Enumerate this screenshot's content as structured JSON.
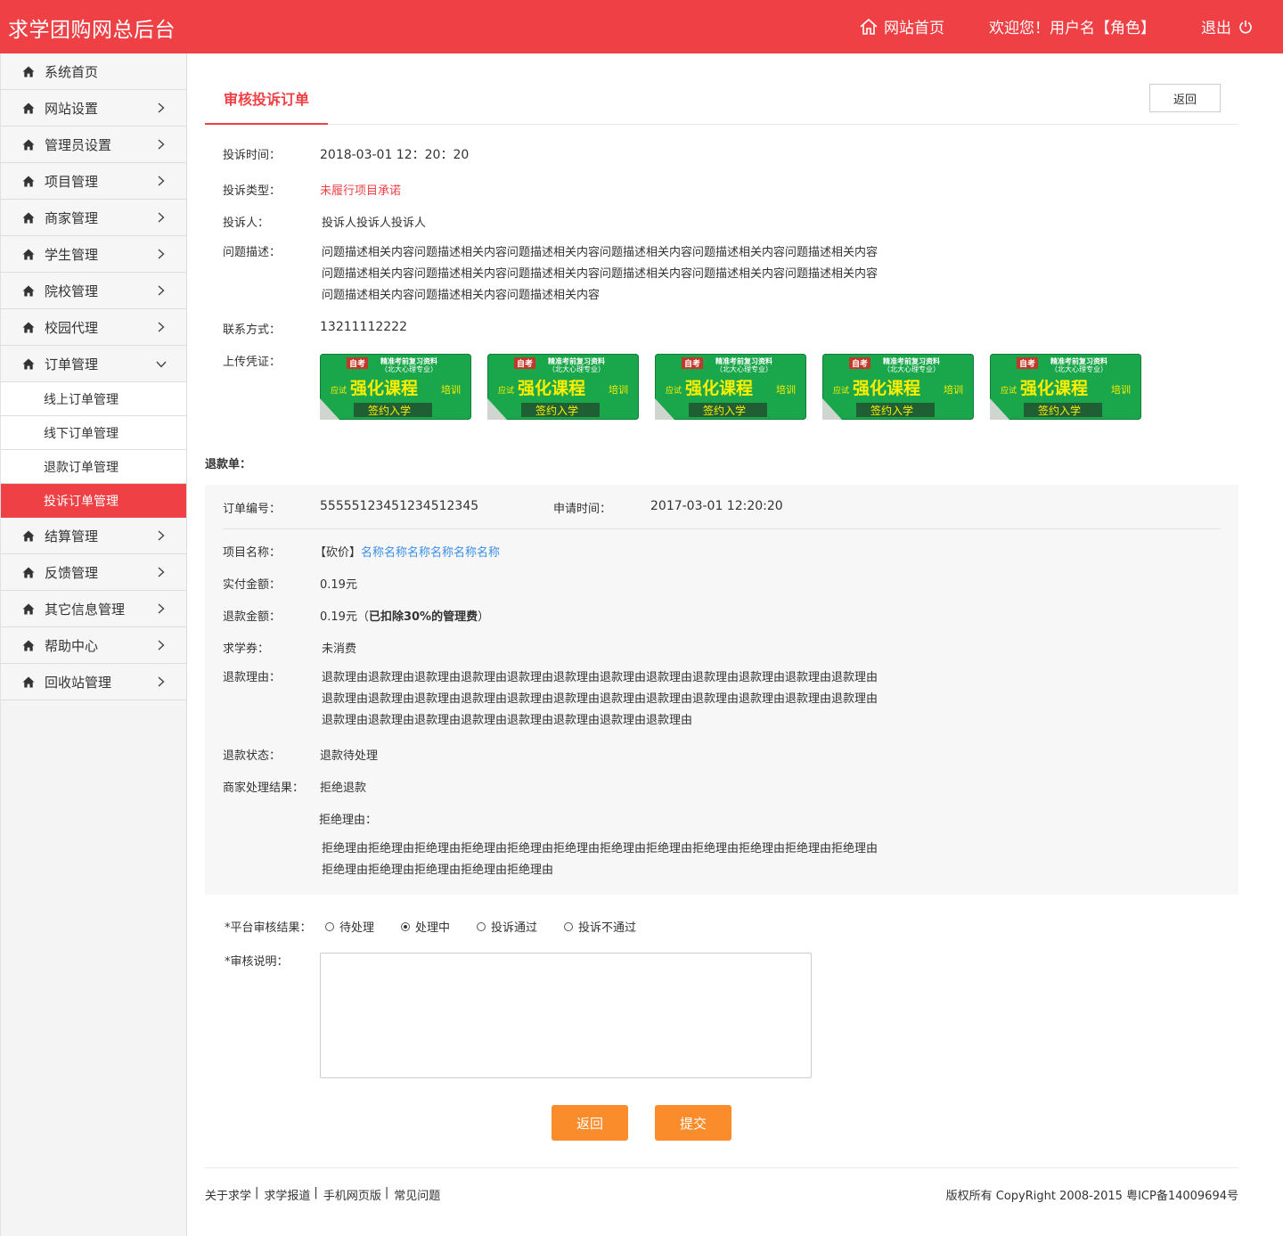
{
  "header": {
    "brand": "求学团购网总后台",
    "home_link": "网站首页",
    "welcome": "欢迎您！用户名【角色】",
    "logout": "退出"
  },
  "sidebar": {
    "items": [
      {
        "label": "系统首页"
      },
      {
        "label": "网站设置"
      },
      {
        "label": "管理员设置"
      },
      {
        "label": "项目管理"
      },
      {
        "label": "商家管理"
      },
      {
        "label": "学生管理"
      },
      {
        "label": "院校管理"
      },
      {
        "label": "校园代理"
      },
      {
        "label": "订单管理"
      },
      {
        "label": "结算管理"
      },
      {
        "label": "反馈管理"
      },
      {
        "label": "其它信息管理"
      },
      {
        "label": "帮助中心"
      },
      {
        "label": "回收站管理"
      }
    ],
    "order_sub": [
      {
        "label": "线上订单管理"
      },
      {
        "label": "线下订单管理"
      },
      {
        "label": "退款订单管理"
      },
      {
        "label": "投诉订单管理"
      }
    ]
  },
  "page": {
    "tab_title": "审核投诉订单",
    "back_top": "返回"
  },
  "complaint": {
    "time_label": "投诉时间：",
    "time": "2018-03-01 12：20：20",
    "type_label": "投诉类型：",
    "type": "未履行项目承诺",
    "person_label": "投诉人：",
    "person": "投诉人投诉人投诉人",
    "desc_label": "问题描述：",
    "desc_line1": "问题描述相关内容问题描述相关内容问题描述相关内容问题描述相关内容问题描述相关内容问题描述相关内容",
    "desc_line2": "问题描述相关内容问题描述相关内容问题描述相关内容问题描述相关内容问题描述相关内容问题描述相关内容",
    "desc_line3": "问题描述相关内容问题描述相关内容问题描述相关内容",
    "contact_label": "联系方式：",
    "contact": "13211112222",
    "upload_label": "上传凭证："
  },
  "voucher_image": {
    "badge": "自考",
    "top1": "精准考前复习资料",
    "top2": "（北大心理专业）",
    "left": "应试",
    "big": "强化课程",
    "right": "培训",
    "bottom": "签约入学"
  },
  "refund": {
    "section_title": "退款单：",
    "order_no_label": "订单编号：",
    "order_no": "55555123451234512345",
    "apply_time_label": "申请时间：",
    "apply_time": "2017-03-01 12:20:20",
    "project_label": "项目名称：",
    "project_tag": "【砍价】",
    "project_name": "名称名称名称名称名称名称",
    "paid_label": "实付金额：",
    "paid": "0.19元",
    "refund_amount_label": "退款金额：",
    "refund_amount_value": "0.19元（",
    "refund_amount_note": "已扣除30%的管理费",
    "refund_amount_close": "）",
    "coupon_label": "求学券：",
    "coupon": "未消费",
    "reason_label": "退款理由：",
    "reason_line1": "退款理由退款理由退款理由退款理由退款理由退款理由退款理由退款理由退款理由退款理由退款理由退款理由",
    "reason_line2": "退款理由退款理由退款理由退款理由退款理由退款理由退款理由退款理由退款理由退款理由退款理由退款理由",
    "reason_line3": "退款理由退款理由退款理由退款理由退款理由退款理由退款理由退款理由",
    "status_label": "退款状态：",
    "status": "退款待处理",
    "merchant_result_label": "商家处理结果：",
    "merchant_result": "拒绝退款",
    "reject_reason_label": "拒绝理由：",
    "reject_line1": "拒绝理由拒绝理由拒绝理由拒绝理由拒绝理由拒绝理由拒绝理由拒绝理由拒绝理由拒绝理由拒绝理由拒绝理由",
    "reject_line2": "拒绝理由拒绝理由拒绝理由拒绝理由拒绝理由"
  },
  "review": {
    "result_label": "*平台审核结果：",
    "options": [
      {
        "label": "待处理",
        "checked": false
      },
      {
        "label": "处理中",
        "checked": true
      },
      {
        "label": "投诉通过",
        "checked": false
      },
      {
        "label": "投诉不通过",
        "checked": false
      }
    ],
    "note_label": "*审核说明：",
    "note_value": "",
    "back_button": "返回",
    "submit_button": "提交"
  },
  "footer": {
    "links": [
      "关于求学",
      "求学报道",
      "手机网页版",
      "常见问题"
    ],
    "separator": "|",
    "copyright": "版权所有 CopyRight 2008-2015 粤ICP备14009694号"
  },
  "colors": {
    "brand_red": "#ee4045",
    "button_orange": "#fb8c2c",
    "link_blue": "#3a8ee6",
    "voucher_green": "#1aa64a",
    "voucher_yellow": "#ffee00"
  },
  "icons": {
    "home": "home-icon",
    "power": "power-icon",
    "chevron_right": "chevron-right-icon",
    "chevron_down": "chevron-down-icon"
  }
}
